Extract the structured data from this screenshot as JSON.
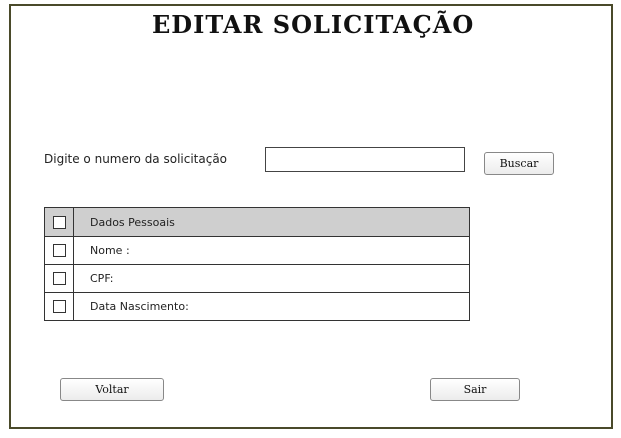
{
  "title": "EDITAR SOLICITAÇÃO",
  "search": {
    "label": "Digite o numero da solicitação",
    "value": "",
    "placeholder": "",
    "button_label": "Buscar"
  },
  "table": {
    "header": "Dados Pessoais",
    "rows": [
      "Nome :",
      "CPF:",
      "Data Nascimento:"
    ]
  },
  "footer": {
    "back_label": "Voltar",
    "exit_label": "Sair"
  }
}
